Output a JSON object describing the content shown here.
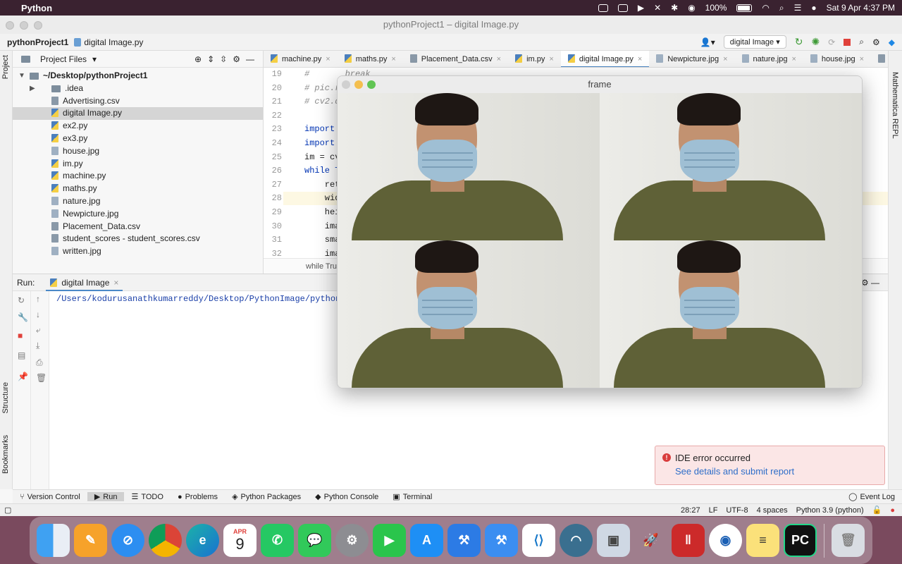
{
  "menubar": {
    "app": "Python",
    "battery": "100%",
    "datetime": "Sat 9 Apr  4:37 PM"
  },
  "window": {
    "title": "pythonProject1 – digital Image.py",
    "breadcrumb_project": "pythonProject1",
    "breadcrumb_file": "digital Image.py",
    "run_config": "digital Image"
  },
  "left_strip": {
    "project": "Project",
    "structure": "Structure",
    "bookmarks": "Bookmarks"
  },
  "right_strip": {
    "label": "Mathematica REPL"
  },
  "project_panel": {
    "header": "Project Files",
    "root": "~/Desktop/pythonProject1",
    "items": [
      {
        "name": ".idea",
        "type": "folder"
      },
      {
        "name": "Advertising.csv",
        "type": "csv"
      },
      {
        "name": "digital Image.py",
        "type": "py",
        "selected": true
      },
      {
        "name": "ex2.py",
        "type": "py"
      },
      {
        "name": "ex3.py",
        "type": "py"
      },
      {
        "name": "house.jpg",
        "type": "jpg"
      },
      {
        "name": "im.py",
        "type": "py"
      },
      {
        "name": "machine.py",
        "type": "py"
      },
      {
        "name": "maths.py",
        "type": "py"
      },
      {
        "name": "nature.jpg",
        "type": "jpg"
      },
      {
        "name": "Newpicture.jpg",
        "type": "jpg"
      },
      {
        "name": "Placement_Data.csv",
        "type": "csv"
      },
      {
        "name": "student_scores - student_scores.csv",
        "type": "csv"
      },
      {
        "name": "written.jpg",
        "type": "jpg"
      }
    ]
  },
  "editor": {
    "tabs": [
      "machine.py",
      "maths.py",
      "Placement_Data.csv",
      "im.py",
      "digital Image.py",
      "Newpicture.jpg",
      "nature.jpg",
      "house.jpg",
      "stu"
    ],
    "active_tab": "digital Image.py",
    "lines": [
      {
        "n": "19",
        "text": "#       break"
      },
      {
        "n": "20",
        "text": "# pic.r"
      },
      {
        "n": "21",
        "text": "# cv2.d"
      },
      {
        "n": "22",
        "text": ""
      },
      {
        "n": "23",
        "text": "import"
      },
      {
        "n": "24",
        "text": "import"
      },
      {
        "n": "25",
        "text": "im = cv"
      },
      {
        "n": "26",
        "text": "while T"
      },
      {
        "n": "27",
        "text": "    ret"
      },
      {
        "n": "28",
        "text": "    wid"
      },
      {
        "n": "29",
        "text": "    hei"
      },
      {
        "n": "30",
        "text": "    ima"
      },
      {
        "n": "31",
        "text": "    sma"
      },
      {
        "n": "32",
        "text": "    ima"
      }
    ],
    "breadcrumb": "while Tru"
  },
  "run_panel": {
    "label": "Run:",
    "tab": "digital Image",
    "output": "/Users/kodurusanathkumarreddy/Desktop/PythonImage/python/b"
  },
  "frame_window": {
    "title": "frame"
  },
  "bottom_tools": [
    "Version Control",
    "Run",
    "TODO",
    "Problems",
    "Python Packages",
    "Python Console",
    "Terminal"
  ],
  "event_log": "Event Log",
  "status": {
    "position": "28:27",
    "line_sep": "LF",
    "encoding": "UTF-8",
    "indent": "4 spaces",
    "interpreter": "Python 3.9 (python)"
  },
  "toast": {
    "title": "IDE error occurred",
    "link": "See details and submit report"
  },
  "dock": {
    "calendar_month": "APR",
    "calendar_day": "9",
    "apps": [
      "finder-icon",
      "pages-icon",
      "safari-icon",
      "chrome-icon",
      "edge-icon",
      "calendar-icon",
      "whatsapp-icon",
      "messages-icon",
      "system-preferences-icon",
      "facetime-icon",
      "app-store-icon",
      "xcode-icon",
      "xcode-beta-icon",
      "vscode-icon",
      "wireshark-icon",
      "preview-icon",
      "rocket-icon",
      "parallels-icon",
      "vpn-icon",
      "notes-icon",
      "pycharm-icon",
      "trash-icon"
    ]
  }
}
